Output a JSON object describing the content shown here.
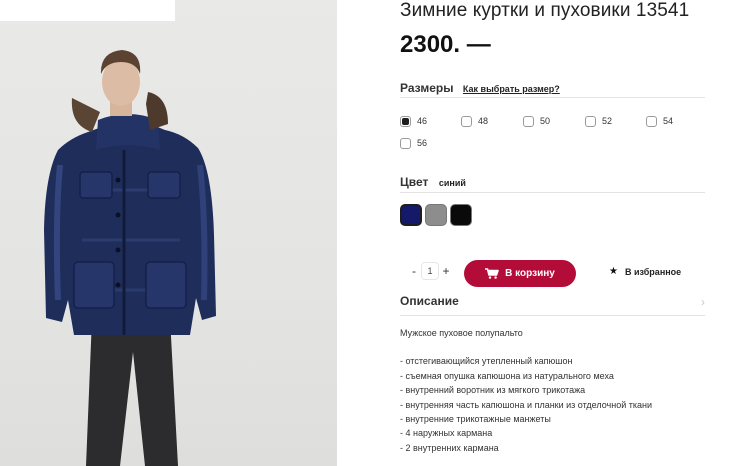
{
  "product": {
    "title": "Зимние куртки и пуховики 13541",
    "price": "2300. —"
  },
  "sizes": {
    "label": "Размеры",
    "guide_link": "Как выбрать размер?",
    "options": [
      "46",
      "48",
      "50",
      "52",
      "54",
      "56"
    ],
    "selected": "46"
  },
  "color": {
    "label": "Цвет",
    "selected_name": "синий",
    "swatches": [
      {
        "name": "navy-blue",
        "hex": "#15196a",
        "selected": true
      },
      {
        "name": "gray",
        "hex": "#8d8d8d",
        "selected": false
      },
      {
        "name": "black",
        "hex": "#0a0a0a",
        "selected": false
      }
    ]
  },
  "purchase": {
    "minus": "-",
    "quantity": "1",
    "plus": "+",
    "cart_label": "В корзину",
    "cart_icon": "shopping-cart-icon",
    "favorite_label": "В избранное",
    "favorite_icon": "star-icon"
  },
  "description": {
    "label": "Описание",
    "chevron_icon": "chevron-right-icon",
    "intro": "Мужское пуховое полупальто",
    "items": [
      "- отстегивающийся утепленный капюшон",
      "- съемная опушка капюшона из натурального меха",
      "- внутренний воротник из мягкого трикотажа",
      "- внутренняя часть капюшона и планки из отделочной ткани",
      "- внутренние трикотажные манжеты",
      "- 4 наружных кармана",
      "- 2 внутренних кармана"
    ]
  },
  "colors": {
    "accent": "#b40c38",
    "divider": "#e3e3e3"
  }
}
